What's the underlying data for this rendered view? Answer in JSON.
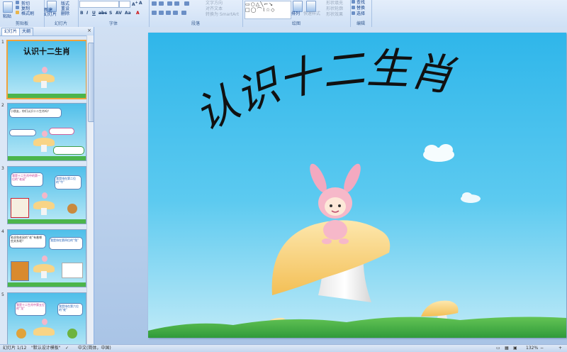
{
  "ribbon": {
    "clipboard": {
      "paste": "粘贴",
      "cut": "剪切",
      "copy": "复制",
      "format_painter": "格式刷",
      "group_label": "剪贴板"
    },
    "slides": {
      "new_slide": "新建\n幻灯片",
      "layout": "版式",
      "reset": "重设",
      "delete": "删除",
      "group_label": "幻灯片"
    },
    "font": {
      "group_label": "字体"
    },
    "paragraph": {
      "text_direction": "文字方向",
      "align_text": "对齐文本",
      "smartart": "转换为 SmartArt",
      "group_label": "段落"
    },
    "drawing": {
      "arrange": "排列",
      "quick_styles": "快速样式",
      "shape_fill": "形状填充",
      "shape_outline": "形状轮廓",
      "shape_effects": "形状效果",
      "group_label": "绘图"
    },
    "editing": {
      "find": "查找",
      "replace": "替换",
      "select": "选择",
      "group_label": "编辑"
    }
  },
  "panel": {
    "tab_slides": "幻灯片",
    "tab_outline": "大纲",
    "close": "×",
    "thumbs": [
      {
        "num": "1",
        "title": "认识十二生肖"
      },
      {
        "num": "2",
        "bubble1": "小朋友，你们认识十二生肖吗？",
        "bubble2": "",
        "bubble3": "",
        "bubble4": ""
      },
      {
        "num": "3",
        "bubble1": "我是十二生肖中的第一位的“老鼠”",
        "bubble2": "我是排在第二位的“牛”"
      },
      {
        "num": "4",
        "bubble1": "老虎和老鼠的“老”有着哪些关系呢？",
        "bubble2": "我是排在第四位的“兔”"
      },
      {
        "num": "5",
        "bubble1": "我是十二生肖中第五位的“龙”",
        "bubble2": "我是排在第六位的“蛇”"
      }
    ]
  },
  "slide": {
    "title": "认识十二生肖"
  },
  "status": {
    "slide_info": "幻灯片 1/12",
    "theme": "\"默认设计模板\"",
    "language": "中文(简体，中国)",
    "zoom": "132%"
  },
  "colors": {
    "sky_top": "#2fb6ea",
    "sky_bottom": "#bfeaf7",
    "grass": "#3aa83f",
    "mushroom": "#f8d486",
    "bunny": "#f3b7c9"
  }
}
